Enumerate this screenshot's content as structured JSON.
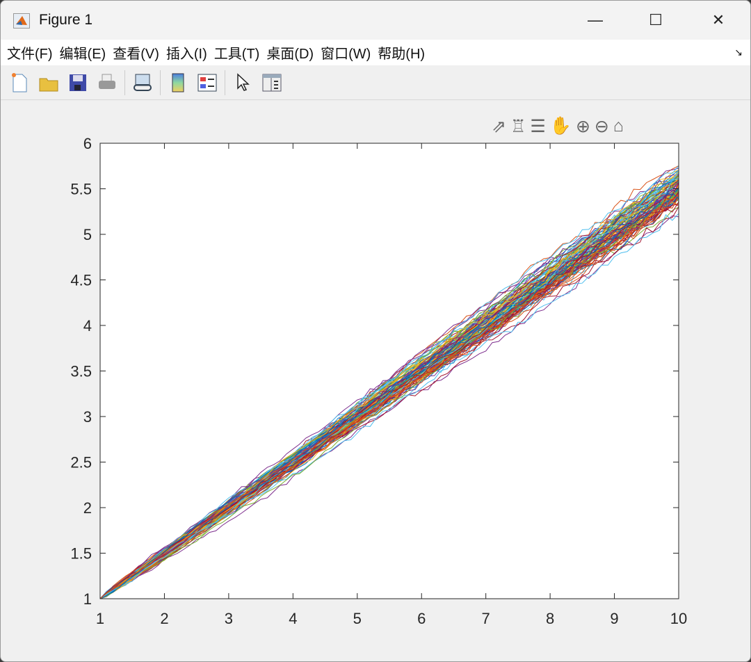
{
  "window": {
    "title": "Figure 1",
    "minimize": "—",
    "maximize": "☐",
    "close": "✕"
  },
  "menu": [
    "文件(F)",
    "编辑(E)",
    "查看(V)",
    "插入(I)",
    "工具(T)",
    "桌面(D)",
    "窗口(W)",
    "帮助(H)"
  ],
  "menu_corner": "↘",
  "toolbar": [
    "new-figure",
    "open",
    "save",
    "print",
    "link-plot",
    "colorbar",
    "legend",
    "edit-plot",
    "property-inspector"
  ],
  "axes_toolbar": [
    {
      "name": "export",
      "glyph": "⇗"
    },
    {
      "name": "brush",
      "glyph": "♖"
    },
    {
      "name": "data-tips",
      "glyph": "☰"
    },
    {
      "name": "pan",
      "glyph": "✋"
    },
    {
      "name": "zoom-in",
      "glyph": "⊕"
    },
    {
      "name": "zoom-out",
      "glyph": "⊖"
    },
    {
      "name": "home",
      "glyph": "⌂"
    }
  ],
  "chart_data": {
    "type": "line",
    "title": "",
    "xlabel": "",
    "ylabel": "",
    "xlim": [
      1,
      10
    ],
    "ylim": [
      1,
      6
    ],
    "xticks": [
      "1",
      "2",
      "3",
      "4",
      "5",
      "6",
      "7",
      "8",
      "9",
      "10"
    ],
    "yticks": [
      "1",
      "1.5",
      "2",
      "2.5",
      "3",
      "3.5",
      "4",
      "4.5",
      "5",
      "5.5",
      "6"
    ],
    "description_of_series": "~100 noisy random-walk series from (1,1), mean trend y = 1 + 0.5(x-1), x step 0.1, spread reaching about 5.2-5.75 at x=10",
    "mean_trend": {
      "x": [
        1,
        2,
        3,
        4,
        5,
        6,
        7,
        8,
        9,
        10
      ],
      "y": [
        1,
        1.5,
        2,
        2.5,
        3,
        3.5,
        4,
        4.5,
        5,
        5.5
      ]
    },
    "series_count": 100,
    "colors": [
      "#0072BD",
      "#D95319",
      "#EDB120",
      "#7E2F8E",
      "#77AC30",
      "#4DBEEE",
      "#A2142F"
    ]
  }
}
